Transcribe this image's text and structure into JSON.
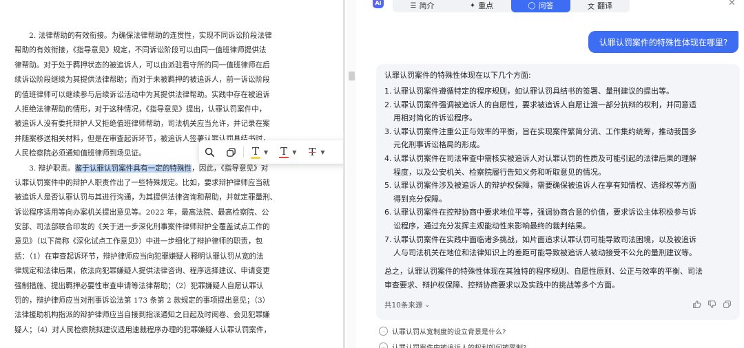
{
  "document": {
    "paragraphs": [
      {
        "lines": [
          "　　2. 法律帮助的有效衔接。为确保法律帮助的连贯性，实现不同诉讼阶段法律",
          "帮助的有效衔接，《指导意见》规定，不同诉讼阶段可以由同一值班律师提供法",
          "律帮助。对于处于羁押状态的被追诉人，可以由派驻看守所的同一值班律师在后",
          "续诉讼阶段继续为其提供法律帮助；而对于未被羁押的被追诉人，前一诉讼阶段",
          "的值班律师可以继续参与后续诉讼活动中为其提供法律帮助。实践中存在被追诉",
          "人拒绝法律帮助的情形，对于这种情况，《指导意见》提出，认罪认罚案件中，",
          "被追诉人没有委托辩护人又拒绝值班律师帮助，司法机关应当允许，并记录在案",
          "并随案移送相关材料，但是在审查起诉环节，被追诉人签署认罪认罚具结书时，",
          "人民检察院必须通知值班律师到场见证。"
        ]
      },
      {
        "lines_before": "　　3. 辩护职责。",
        "highlight": "鉴于认罪认罚案件具有一定的特殊性",
        "lines_after_first": "，因此，《指导意见》对",
        "lines": [
          "认罪认罚案件中的辩护人职责作出了一些特殊规定。比如，要求辩护律师应当就",
          "被追诉人是否认罪认罚与其进行沟通，为其提供法律咨询和帮助，并就定罪量刑、",
          "诉讼程序适用等向办案机关提出意见等。2022 年，最高法院、最高检察院、公",
          "安部、司法部联合印发的《关于进一步深化刑事案件律师辩护全覆盖试点工作的",
          "意见》（以下简称《深化试点工作意见》）中进一步细化了辩护律师的职责，包",
          "括：（1）在审查起诉环节，辩护律师应当向犯罪嫌疑人释明认罪认罚从宽的法",
          "律规定和法律后果，依法向犯罪嫌疑人提供法律咨询、程序选择建议、申请变更",
          "强制措施、提出羁押必要性审查申请等法律帮助；（2）犯罪嫌疑人自愿认罪认",
          "罚的，辩护律师应当对刑事诉讼法第 173 条第 2 款规定的事项提出意见；（3）",
          "法律援助机构指派的辩护律师应当自接到指派通知之日起及时阅卷、会见犯罪嫌",
          "疑人；（4）对人民检察院拟建议适用速裁程序办理的犯罪嫌疑人认罪认罚案件，"
        ]
      }
    ]
  },
  "selection_toolbar": {
    "tools": [
      "search-icon",
      "copy-icon",
      "highlight-text-icon",
      "underline-text-icon",
      "strikethrough-text-icon"
    ],
    "text_tool_glyph": "T",
    "colors": {
      "highlight": "#f6d54a",
      "underline": "#e04a3f",
      "strike": "#e04a3f"
    }
  },
  "ai_panel": {
    "logo_text": "Ai",
    "tabs": [
      {
        "label": "简介",
        "icon": "summary-icon",
        "active": false
      },
      {
        "label": "重点",
        "icon": "sparkle-icon",
        "active": false
      },
      {
        "label": "问答",
        "icon": "chat-icon",
        "active": true
      },
      {
        "label": "翻译",
        "icon": "translate-icon",
        "active": false
      }
    ],
    "accent_color": "#3d6df2",
    "user_question": "认罪认罚案件的特殊性体现在哪里?",
    "answer": {
      "intro": "认罪认罚案件的特殊性体现在以下几个方面:",
      "items": [
        {
          "num": "1.",
          "lines": [
            "认罪认罚案件遵循特定的程序规则，如认罪认罚具结书的签署、量刑建议的提出等。"
          ]
        },
        {
          "num": "2.",
          "lines": [
            "认罪认罚案件强调被追诉人的自愿性，要求被追诉人自愿让渡一部分抗辩的权利，并同意适",
            "用相对简化的诉讼程序。"
          ]
        },
        {
          "num": "3.",
          "lines": [
            "认罪认罚案件注重公正与效率的平衡，旨在实现案件繁简分流、工作集约统筹，推动我国多",
            "元化刑事诉讼格局的形成。"
          ]
        },
        {
          "num": "4.",
          "lines": [
            "认罪认罚案件在司法审查中需核实被追诉人对认罪认罚的性质及可能引起的法律后果的理解",
            "程度，以及公安机关、检察院履行告知义务和听取意见的情况。"
          ]
        },
        {
          "num": "5.",
          "lines": [
            "认罪认罚案件涉及被追诉人的辩护权保障，需要确保被追诉人在享有知情权、选择权等方面",
            "得到充分保障。"
          ]
        },
        {
          "num": "6.",
          "lines": [
            "认罪认罚案件在控辩协商中要求地位平等，强调协商合意的价值，要求诉讼主体积极参与诉",
            "讼程序，通过充分发挥主观能动性来影响最终的裁判结果。"
          ]
        },
        {
          "num": "7.",
          "lines": [
            "认罪认罚案件在实践中面临诸多挑战，如片面追求认罪认罚可能导致司法困境，以及被追诉",
            "人与司法机关在地位和法律知识上的差距可能导致被追诉人被动接受不公允的量刑建议等。"
          ]
        }
      ],
      "summary_lines": [
        "总之，认罪认罚案件的特殊性体现在其独特的程序规则、自愿性原则、公正与效率的平衡、司法",
        "审查要求、辩护权保障、控辩协商要求以及实践中的挑战等多个方面。"
      ],
      "sources_label": "共10条来源",
      "actions": [
        "thumbs-up-icon",
        "thumbs-down-icon",
        "copy-icon"
      ]
    },
    "suggestions": [
      "认罪认罚从宽制度的设立背景是什么?",
      "认罪认罚案件中被追诉人的权利如何被限制?"
    ]
  }
}
